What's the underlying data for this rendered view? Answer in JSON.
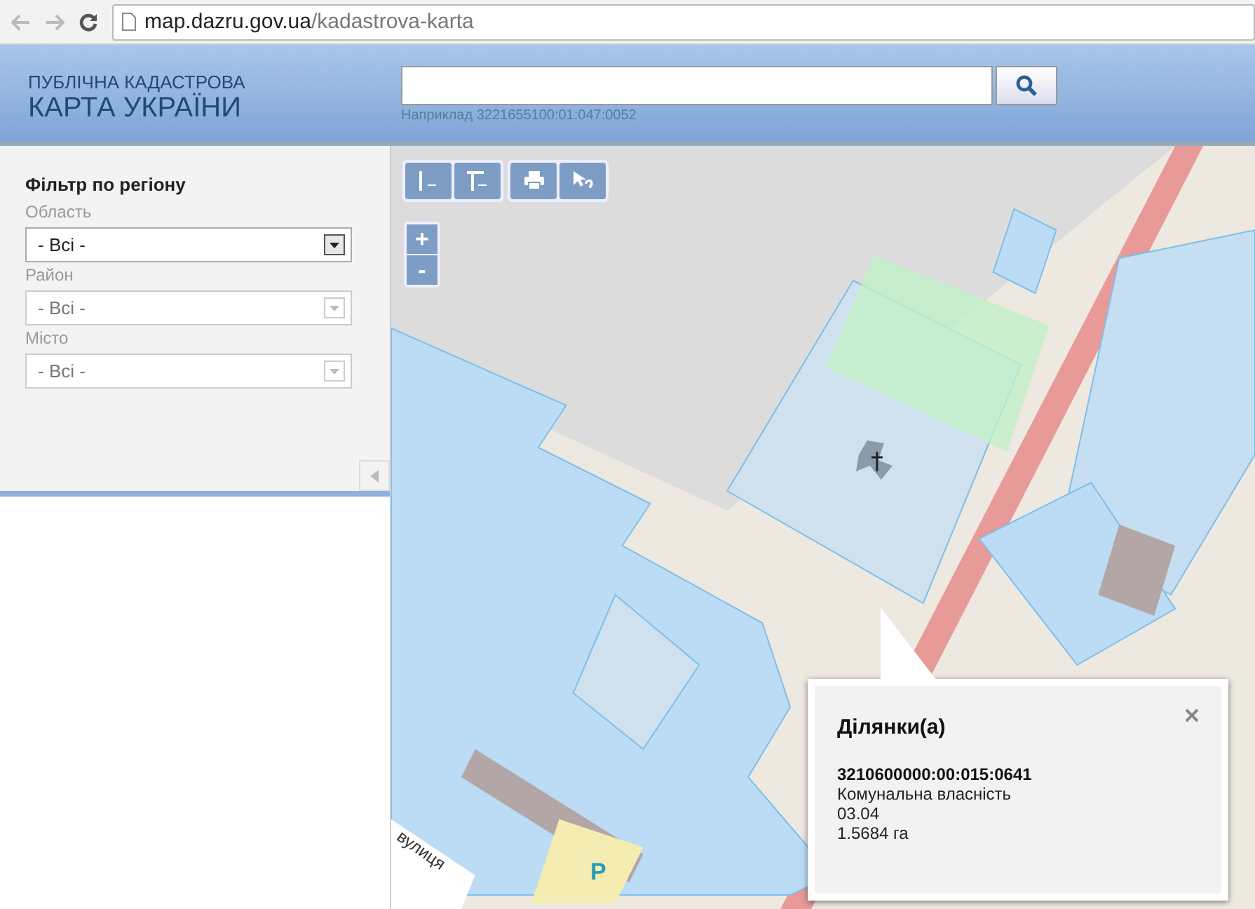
{
  "browser": {
    "url_host": "map.dazru.gov.ua",
    "url_path": "/kadastrova-karta"
  },
  "header": {
    "title_line_1": "ПУБЛІЧНА КАДАСТРОВА",
    "title_line_2": "КАРТА УКРАЇНИ",
    "search": {
      "hint": "Наприклад 3221655100:01:047:0052"
    }
  },
  "filter": {
    "title": "Фільтр по регіону",
    "fields": [
      {
        "label": "Область",
        "value": "- Всі -",
        "disabled": false
      },
      {
        "label": "Район",
        "value": "- Всі -",
        "disabled": true
      },
      {
        "label": "Місто",
        "value": "- Всі -",
        "disabled": true
      }
    ]
  },
  "map": {
    "zoom_in": "+",
    "zoom_out": "-",
    "street_label": "вулиця",
    "parking_label": "P"
  },
  "popup": {
    "title": "Ділянки(а)",
    "cadastral_number": "3210600000:00:015:0641",
    "ownership": "Комунальна власність",
    "purpose_code": "03.04",
    "area": "1.5684 га"
  }
}
